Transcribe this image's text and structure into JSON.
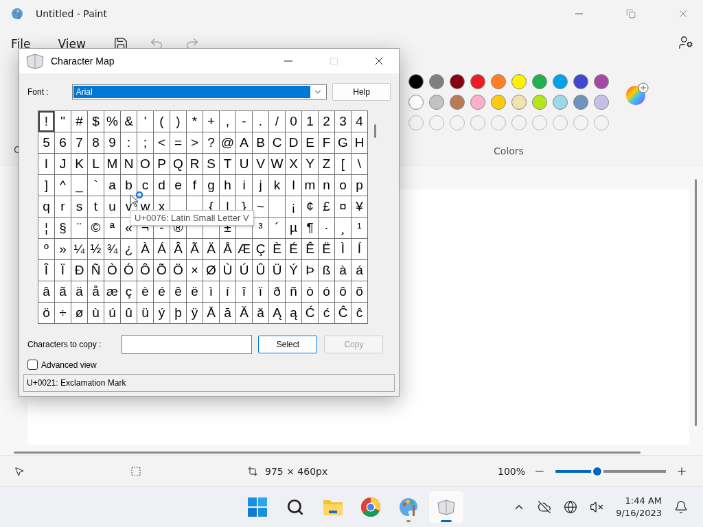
{
  "paint": {
    "title": "Untitled - Paint",
    "menu": [
      {
        "label": "File"
      },
      {
        "label": "View"
      }
    ],
    "ribbon_fragment": "C",
    "colors": {
      "label": "Colors",
      "swatches": [
        {
          "kind": "filled",
          "color": "#000000"
        },
        {
          "kind": "filled",
          "color": "#7f7f7f"
        },
        {
          "kind": "filled",
          "color": "#880015"
        },
        {
          "kind": "filled",
          "color": "#ed1c24"
        },
        {
          "kind": "filled",
          "color": "#ff7f27"
        },
        {
          "kind": "filled",
          "color": "#fff200"
        },
        {
          "kind": "filled",
          "color": "#22b14c"
        },
        {
          "kind": "filled",
          "color": "#00a2e8"
        },
        {
          "kind": "filled",
          "color": "#3f48cc"
        },
        {
          "kind": "filled",
          "color": "#a349a4"
        },
        {
          "kind": "filled",
          "color": "#ffffff"
        },
        {
          "kind": "filled",
          "color": "#c3c3c3"
        },
        {
          "kind": "filled",
          "color": "#b97a57"
        },
        {
          "kind": "filled",
          "color": "#ffaec9"
        },
        {
          "kind": "filled",
          "color": "#ffc90e"
        },
        {
          "kind": "filled",
          "color": "#efe4b0"
        },
        {
          "kind": "filled",
          "color": "#b5e61d"
        },
        {
          "kind": "filled",
          "color": "#99d9ea"
        },
        {
          "kind": "filled",
          "color": "#7092be"
        },
        {
          "kind": "filled",
          "color": "#c8bfe7"
        },
        {
          "kind": "empty"
        },
        {
          "kind": "empty"
        },
        {
          "kind": "empty"
        },
        {
          "kind": "empty"
        },
        {
          "kind": "empty"
        },
        {
          "kind": "empty"
        },
        {
          "kind": "empty"
        },
        {
          "kind": "empty"
        },
        {
          "kind": "empty"
        },
        {
          "kind": "empty"
        }
      ]
    },
    "canvas_size": "975 × 460px",
    "zoom": {
      "reading": "100%",
      "level": 0.38
    }
  },
  "character_map": {
    "title": "Character Map",
    "font_label": "Font :",
    "font_value": "Arial",
    "help_button": "Help",
    "grid": [
      [
        {
          "char": "!",
          "selected": true
        },
        {
          "char": "\"",
          "selected": false
        },
        {
          "char": "#",
          "selected": false
        },
        {
          "char": "$",
          "selected": false
        },
        {
          "char": "%",
          "selected": false
        },
        {
          "char": "&",
          "selected": false
        },
        {
          "char": "'",
          "selected": false
        },
        {
          "char": "(",
          "selected": false
        },
        {
          "char": ")",
          "selected": false
        },
        {
          "char": "*",
          "selected": false
        },
        {
          "char": "+",
          "selected": false
        },
        {
          "char": ",",
          "selected": false
        },
        {
          "char": "-",
          "selected": false
        },
        {
          "char": ".",
          "selected": false
        },
        {
          "char": "/",
          "selected": false
        },
        {
          "char": "0",
          "selected": false
        },
        {
          "char": "1",
          "selected": false
        },
        {
          "char": "2",
          "selected": false
        },
        {
          "char": "3",
          "selected": false
        },
        {
          "char": "4",
          "selected": false
        }
      ],
      [
        {
          "char": "5",
          "selected": false
        },
        {
          "char": "6",
          "selected": false
        },
        {
          "char": "7",
          "selected": false
        },
        {
          "char": "8",
          "selected": false
        },
        {
          "char": "9",
          "selected": false
        },
        {
          "char": ":",
          "selected": false
        },
        {
          "char": ";",
          "selected": false
        },
        {
          "char": "<",
          "selected": false
        },
        {
          "char": "=",
          "selected": false
        },
        {
          "char": ">",
          "selected": false
        },
        {
          "char": "?",
          "selected": false
        },
        {
          "char": "@",
          "selected": false
        },
        {
          "char": "A",
          "selected": false
        },
        {
          "char": "B",
          "selected": false
        },
        {
          "char": "C",
          "selected": false
        },
        {
          "char": "D",
          "selected": false
        },
        {
          "char": "E",
          "selected": false
        },
        {
          "char": "F",
          "selected": false
        },
        {
          "char": "G",
          "selected": false
        },
        {
          "char": "H",
          "selected": false
        }
      ],
      [
        {
          "char": "I",
          "selected": false
        },
        {
          "char": "J",
          "selected": false
        },
        {
          "char": "K",
          "selected": false
        },
        {
          "char": "L",
          "selected": false
        },
        {
          "char": "M",
          "selected": false
        },
        {
          "char": "N",
          "selected": false
        },
        {
          "char": "O",
          "selected": false
        },
        {
          "char": "P",
          "selected": false
        },
        {
          "char": "Q",
          "selected": false
        },
        {
          "char": "R",
          "selected": false
        },
        {
          "char": "S",
          "selected": false
        },
        {
          "char": "T",
          "selected": false
        },
        {
          "char": "U",
          "selected": false
        },
        {
          "char": "V",
          "selected": false
        },
        {
          "char": "W",
          "selected": false
        },
        {
          "char": "X",
          "selected": false
        },
        {
          "char": "Y",
          "selected": false
        },
        {
          "char": "Z",
          "selected": false
        },
        {
          "char": "[",
          "selected": false
        },
        {
          "char": "\\",
          "selected": false
        }
      ],
      [
        {
          "char": "]",
          "selected": false
        },
        {
          "char": "^",
          "selected": false
        },
        {
          "char": "_",
          "selected": false
        },
        {
          "char": "`",
          "selected": false
        },
        {
          "char": "a",
          "selected": false
        },
        {
          "char": "b",
          "selected": false
        },
        {
          "char": "c",
          "selected": false
        },
        {
          "char": "d",
          "selected": false
        },
        {
          "char": "e",
          "selected": false
        },
        {
          "char": "f",
          "selected": false
        },
        {
          "char": "g",
          "selected": false
        },
        {
          "char": "h",
          "selected": false
        },
        {
          "char": "i",
          "selected": false
        },
        {
          "char": "j",
          "selected": false
        },
        {
          "char": "k",
          "selected": false
        },
        {
          "char": "l",
          "selected": false
        },
        {
          "char": "m",
          "selected": false
        },
        {
          "char": "n",
          "selected": false
        },
        {
          "char": "o",
          "selected": false
        },
        {
          "char": "p",
          "selected": false
        }
      ],
      [
        {
          "char": "q",
          "selected": false
        },
        {
          "char": "r",
          "selected": false
        },
        {
          "char": "s",
          "selected": false
        },
        {
          "char": "t",
          "selected": false
        },
        {
          "char": "u",
          "selected": false
        },
        {
          "char": "v",
          "selected": false
        },
        {
          "char": "w",
          "selected": false
        },
        {
          "char": "x",
          "selected": false
        },
        {
          "selected": false
        },
        {
          "selected": false
        },
        {
          "char": "{",
          "selected": false
        },
        {
          "char": "|",
          "selected": false
        },
        {
          "char": "}",
          "selected": false
        },
        {
          "char": "~",
          "selected": false
        },
        {
          "selected": false
        },
        {
          "char": "¡",
          "selected": false
        },
        {
          "char": "¢",
          "selected": false
        },
        {
          "char": "£",
          "selected": false
        },
        {
          "char": "¤",
          "selected": false
        },
        {
          "char": "¥",
          "selected": false
        }
      ],
      [
        {
          "char": "¦",
          "selected": false
        },
        {
          "char": "§",
          "selected": false
        },
        {
          "char": "¨",
          "selected": false
        },
        {
          "char": "©",
          "selected": false
        },
        {
          "char": "ª",
          "selected": false
        },
        {
          "char": "«",
          "selected": false
        },
        {
          "char": "¬",
          "selected": false
        },
        {
          "char": "-",
          "selected": false
        },
        {
          "char": "®",
          "selected": false
        },
        {
          "selected": false
        },
        {
          "selected": false
        },
        {
          "char": "±",
          "selected": false
        },
        {
          "selected": false
        },
        {
          "char": "³",
          "selected": false
        },
        {
          "char": "´",
          "selected": false
        },
        {
          "char": "µ",
          "selected": false
        },
        {
          "char": "¶",
          "selected": false
        },
        {
          "char": "·",
          "selected": false
        },
        {
          "char": "¸",
          "selected": false
        },
        {
          "char": "¹",
          "selected": false
        }
      ],
      [
        {
          "char": "º",
          "selected": false
        },
        {
          "char": "»",
          "selected": false
        },
        {
          "char": "¼",
          "selected": false
        },
        {
          "char": "½",
          "selected": false
        },
        {
          "char": "¾",
          "selected": false
        },
        {
          "char": "¿",
          "selected": false
        },
        {
          "char": "À",
          "selected": false
        },
        {
          "char": "Á",
          "selected": false
        },
        {
          "char": "Â",
          "selected": false
        },
        {
          "char": "Ã",
          "selected": false
        },
        {
          "char": "Ä",
          "selected": false
        },
        {
          "char": "Å",
          "selected": false
        },
        {
          "char": "Æ",
          "selected": false
        },
        {
          "char": "Ç",
          "selected": false
        },
        {
          "char": "È",
          "selected": false
        },
        {
          "char": "É",
          "selected": false
        },
        {
          "char": "Ê",
          "selected": false
        },
        {
          "char": "Ë",
          "selected": false
        },
        {
          "char": "Ì",
          "selected": false
        },
        {
          "char": "Í",
          "selected": false
        }
      ],
      [
        {
          "char": "Î",
          "selected": false
        },
        {
          "char": "Ï",
          "selected": false
        },
        {
          "char": "Ð",
          "selected": false
        },
        {
          "char": "Ñ",
          "selected": false
        },
        {
          "char": "Ò",
          "selected": false
        },
        {
          "char": "Ó",
          "selected": false
        },
        {
          "char": "Ô",
          "selected": false
        },
        {
          "char": "Õ",
          "selected": false
        },
        {
          "char": "Ö",
          "selected": false
        },
        {
          "char": "×",
          "selected": false
        },
        {
          "char": "Ø",
          "selected": false
        },
        {
          "char": "Ù",
          "selected": false
        },
        {
          "char": "Ú",
          "selected": false
        },
        {
          "char": "Û",
          "selected": false
        },
        {
          "char": "Ü",
          "selected": false
        },
        {
          "char": "Ý",
          "selected": false
        },
        {
          "char": "Þ",
          "selected": false
        },
        {
          "char": "ß",
          "selected": false
        },
        {
          "char": "à",
          "selected": false
        },
        {
          "char": "á",
          "selected": false
        }
      ],
      [
        {
          "char": "â",
          "selected": false
        },
        {
          "char": "ã",
          "selected": false
        },
        {
          "char": "ä",
          "selected": false
        },
        {
          "char": "å",
          "selected": false
        },
        {
          "char": "æ",
          "selected": false
        },
        {
          "char": "ç",
          "selected": false
        },
        {
          "char": "è",
          "selected": false
        },
        {
          "char": "é",
          "selected": false
        },
        {
          "char": "ê",
          "selected": false
        },
        {
          "char": "ë",
          "selected": false
        },
        {
          "char": "ì",
          "selected": false
        },
        {
          "char": "í",
          "selected": false
        },
        {
          "char": "î",
          "selected": false
        },
        {
          "char": "ï",
          "selected": false
        },
        {
          "char": "ð",
          "selected": false
        },
        {
          "char": "ñ",
          "selected": false
        },
        {
          "char": "ò",
          "selected": false
        },
        {
          "char": "ó",
          "selected": false
        },
        {
          "char": "ô",
          "selected": false
        },
        {
          "char": "õ",
          "selected": false
        }
      ],
      [
        {
          "char": "ö",
          "selected": false
        },
        {
          "char": "÷",
          "selected": false
        },
        {
          "char": "ø",
          "selected": false
        },
        {
          "char": "ù",
          "selected": false
        },
        {
          "char": "ú",
          "selected": false
        },
        {
          "char": "û",
          "selected": false
        },
        {
          "char": "ü",
          "selected": false
        },
        {
          "char": "ý",
          "selected": false
        },
        {
          "char": "þ",
          "selected": false
        },
        {
          "char": "ÿ",
          "selected": false
        },
        {
          "char": "Ā",
          "selected": false
        },
        {
          "char": "ā",
          "selected": false
        },
        {
          "char": "Ă",
          "selected": false
        },
        {
          "char": "ă",
          "selected": false
        },
        {
          "char": "Ą",
          "selected": false
        },
        {
          "char": "ą",
          "selected": false
        },
        {
          "char": "Ć",
          "selected": false
        },
        {
          "char": "ć",
          "selected": false
        },
        {
          "char": "Ĉ",
          "selected": false
        },
        {
          "char": "ĉ",
          "selected": false
        }
      ]
    ],
    "tooltip": "U+0076: Latin Small Letter V",
    "copy_label": "Characters to copy :",
    "select_button": {
      "label": "Select",
      "focused": true
    },
    "copy_button": {
      "label": "Copy",
      "disabled": true
    },
    "advanced_view": {
      "label": "Advanced view",
      "checked": false
    },
    "status": "U+0021: Exclamation Mark"
  },
  "taskbar": {
    "apps": [
      {
        "kind": "start",
        "running": false,
        "selected": false
      },
      {
        "kind": "search",
        "running": false,
        "selected": false
      },
      {
        "kind": "folder",
        "running": false,
        "selected": false
      },
      {
        "kind": "browser",
        "running": false,
        "selected": false
      },
      {
        "kind": "paint",
        "running": true,
        "selected": false
      },
      {
        "kind": "charmap",
        "running": true,
        "selected": true
      }
    ],
    "time": "1:44 AM",
    "date": "9/16/2023"
  }
}
